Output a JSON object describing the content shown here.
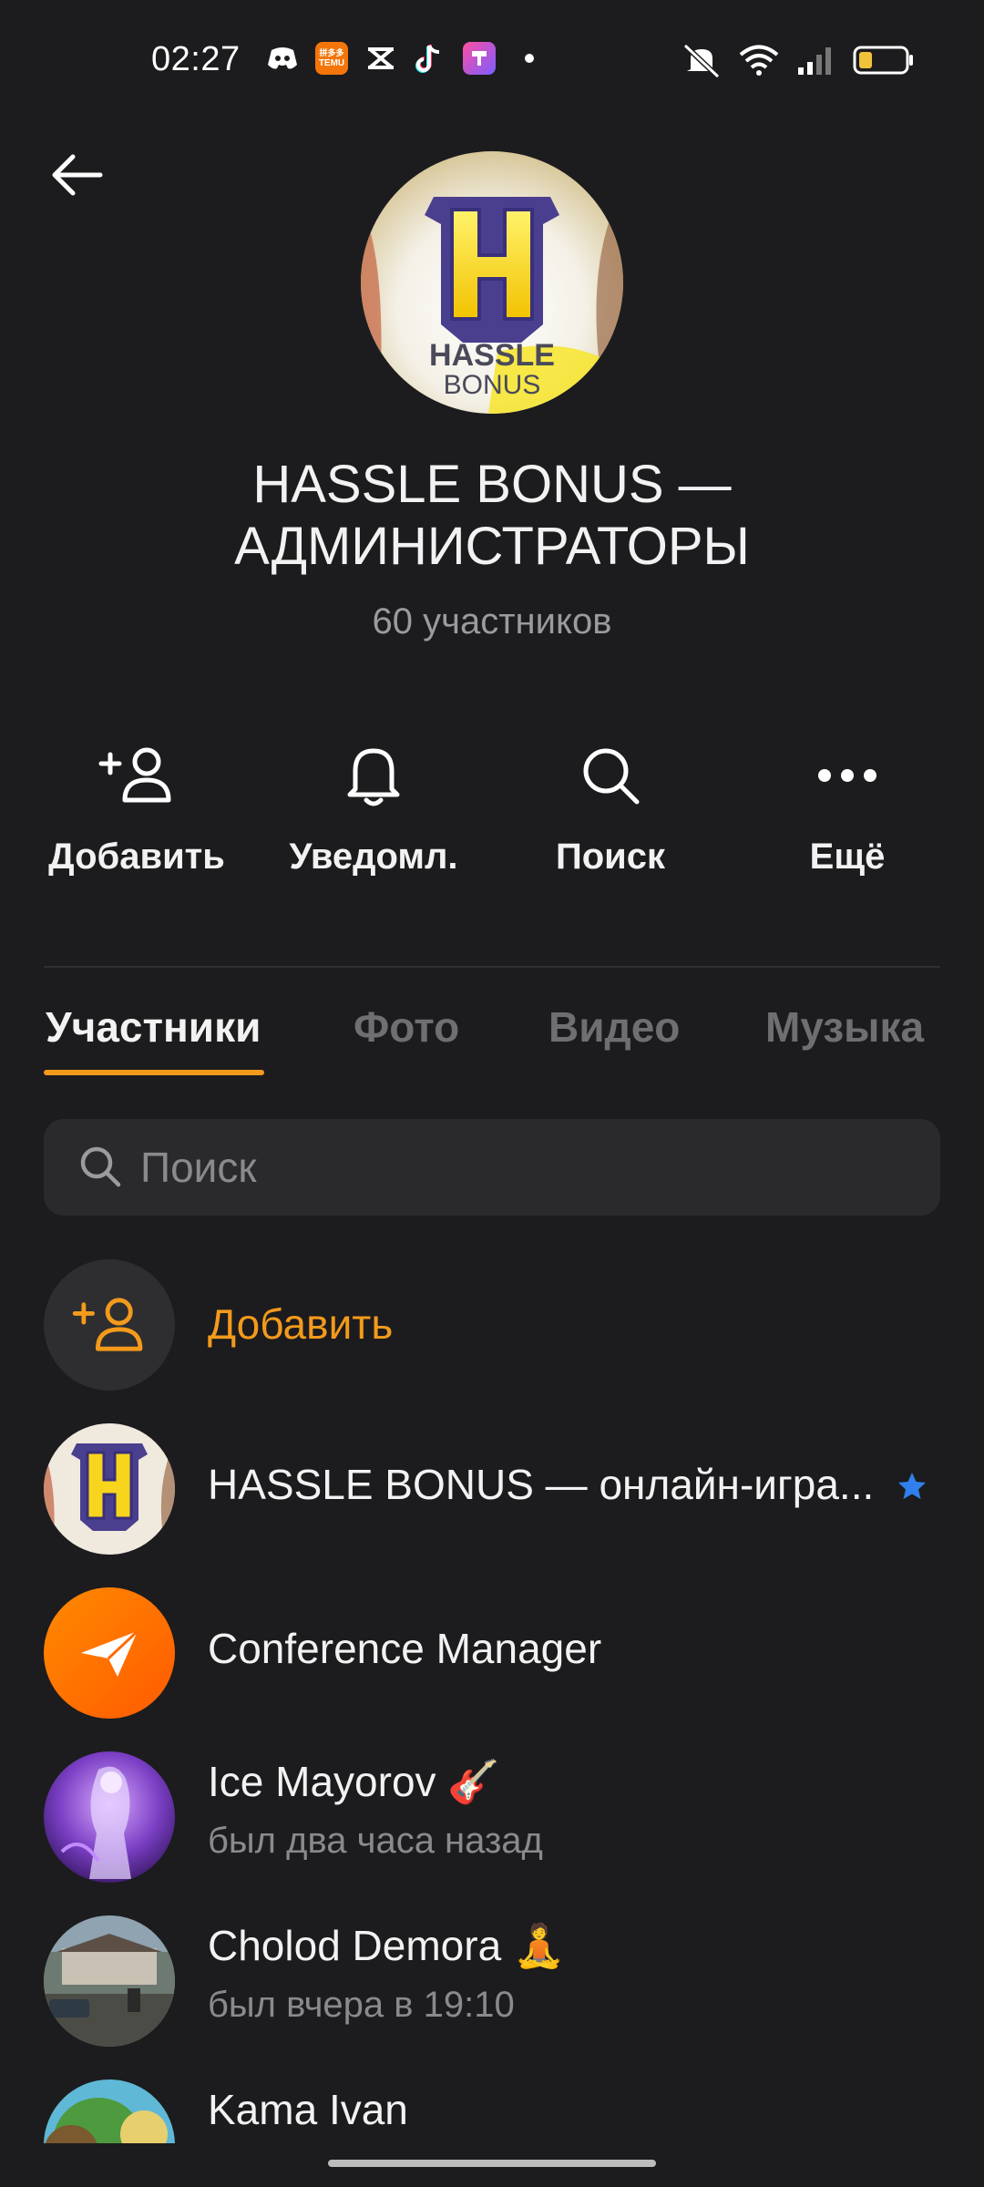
{
  "status_bar": {
    "time": "02:27",
    "apps": [
      "discord-icon",
      "temu-icon",
      "capcut-icon",
      "tiktok-icon",
      "app-icon"
    ],
    "temu_label": "TEMU",
    "temu_sub": "拼多多"
  },
  "group": {
    "avatar_text_top": "HASSLE",
    "avatar_text_bottom": "BONUS",
    "title_line1": "HASSLE BONUS —",
    "title_line2": "АДМИНИСТРАТОРЫ",
    "subtitle": "60 участников"
  },
  "actions": [
    {
      "label": "Добавить",
      "icon": "add-user-icon"
    },
    {
      "label": "Уведомл.",
      "icon": "bell-icon"
    },
    {
      "label": "Поиск",
      "icon": "search-icon"
    },
    {
      "label": "Ещё",
      "icon": "more-icon"
    }
  ],
  "tabs": [
    {
      "label": "Участники",
      "active": true
    },
    {
      "label": "Фото",
      "active": false
    },
    {
      "label": "Видео",
      "active": false
    },
    {
      "label": "Музыка",
      "active": false
    }
  ],
  "search": {
    "placeholder": "Поиск"
  },
  "members": {
    "add_label": "Добавить",
    "items": [
      {
        "name": "HASSLE BONUS — онлайн-игра...",
        "status": "",
        "badge": "star-icon"
      },
      {
        "name": "Conference Manager",
        "status": ""
      },
      {
        "name": "Ice Mayorov",
        "emoji": "🎸",
        "status": "был два часа назад"
      },
      {
        "name": "Cholod Demora",
        "emoji": "🧘",
        "status": "был вчера в 19:10"
      },
      {
        "name": "Kama Ivan",
        "status": ""
      }
    ]
  },
  "colors": {
    "background": "#1c1c1e",
    "accent": "#f39a1c",
    "secondary_text": "#8a8a8e",
    "badge_star": "#2f80ed"
  }
}
